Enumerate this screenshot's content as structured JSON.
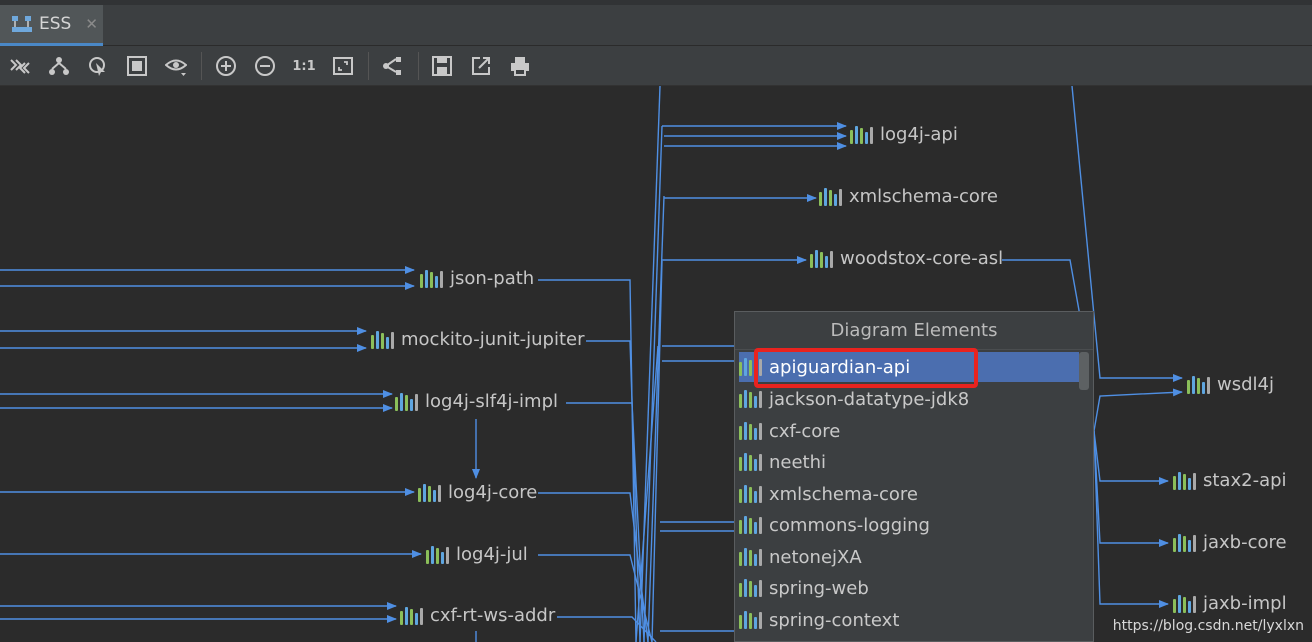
{
  "tab": {
    "title": "ESS",
    "close": "✕"
  },
  "toolbar": {
    "buttons": [
      "expand-all",
      "layout",
      "hand-tool",
      "select-all",
      "visibility",
      "zoom-in",
      "zoom-out",
      "actual-size",
      "fit-content",
      "hierarchy",
      "save",
      "export",
      "print"
    ],
    "actual_size_label": "1:1"
  },
  "nodes": {
    "log4j_api": "log4j-api",
    "xmlschema_core": "xmlschema-core",
    "woodstox_core_asl": "woodstox-core-asl",
    "json_path": "json-path",
    "mockito_junit_jupiter": "mockito-junit-jupiter",
    "log4j_slf4j_impl": "log4j-slf4j-impl",
    "log4j_core": "log4j-core",
    "log4j_jul": "log4j-jul",
    "cxf_rt_ws_addr": "cxf-rt-ws-addr",
    "wsdl4j": "wsdl4j",
    "stax2_api": "stax2-api",
    "jaxb_core": "jaxb-core",
    "jaxb_impl": "jaxb-impl"
  },
  "popup": {
    "title": "Diagram Elements",
    "items": [
      "apiguardian-api",
      "jackson-datatype-jdk8",
      "cxf-core",
      "neethi",
      "xmlschema-core",
      "commons-logging",
      "netonejXA",
      "spring-web",
      "spring-context"
    ],
    "selected": "apiguardian-api"
  },
  "watermark": "https://blog.csdn.net/lyxlxn",
  "colors": {
    "edge": "#4f8fe3",
    "selection": "#4b6eaf",
    "highlight": "#e8231f"
  }
}
